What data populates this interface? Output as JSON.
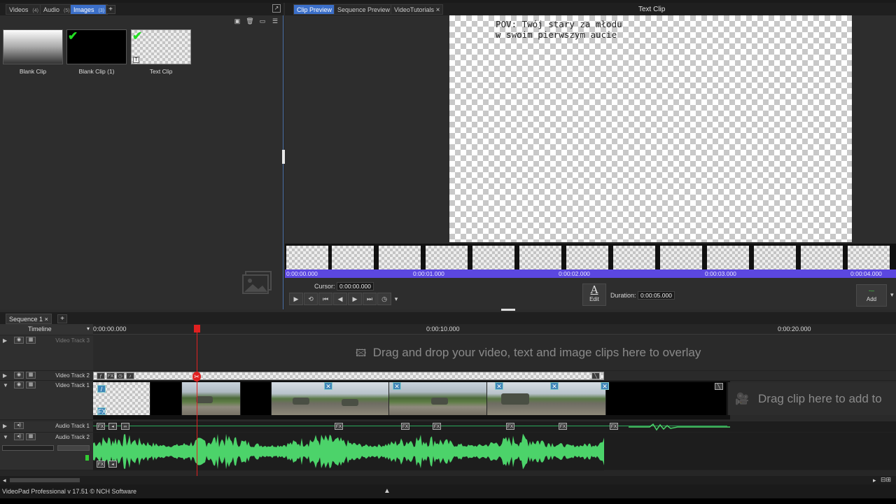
{
  "bin": {
    "tabs": [
      {
        "label": "Videos",
        "count": "(4)"
      },
      {
        "label": "Audio",
        "count": "(5)"
      },
      {
        "label": "Images",
        "count": "(3)"
      }
    ],
    "add_tab": "+",
    "items": [
      {
        "label": "Blank Clip"
      },
      {
        "label": "Blank Clip (1)"
      },
      {
        "label": "Text Clip"
      }
    ]
  },
  "preview": {
    "tabs": [
      {
        "label": "Clip Preview"
      },
      {
        "label": "Sequence Preview"
      },
      {
        "label": "VideoTutorials"
      }
    ],
    "close_glyph": "×",
    "title": "Text Clip",
    "canvas_text": "POV: Twój stary za młodu\nw swoim pierwszym aucie",
    "ruler_ticks": [
      "0:00:00.000",
      "0:00:01.000",
      "0:00:02.000",
      "0:00:03.000",
      "0:00:04.000"
    ],
    "cursor_label": "Cursor:",
    "cursor_value": "0:00:00.000",
    "edit_label": "Edit",
    "duration_label": "Duration:",
    "duration_value": "0:00:05.000",
    "add_label": "Add"
  },
  "sequence": {
    "tab": "Sequence 1",
    "tab_close": "×",
    "add_tab": "+",
    "timeline_label": "Timeline",
    "ruler_ticks": [
      "0:00:00.000",
      "0:00:10.000",
      "0:00:20.000"
    ],
    "tracks": {
      "video3": "Video Track 3",
      "video2": "Video Track 2",
      "video1": "Video Track 1",
      "audio1": "Audio Track 1",
      "audio2": "Audio Track 2"
    },
    "overlay_hint": "Drag and drop your video, text and image clips here to overlay",
    "add_hint": "Drag clip here to add to"
  },
  "status": {
    "text": "VideoPad Professional v 17.51 © NCH Software"
  },
  "colors": {
    "accent": "#3b6fc9",
    "ruler": "#5b47e0",
    "playhead": "#e02020",
    "waveform": "#4cd36a"
  }
}
